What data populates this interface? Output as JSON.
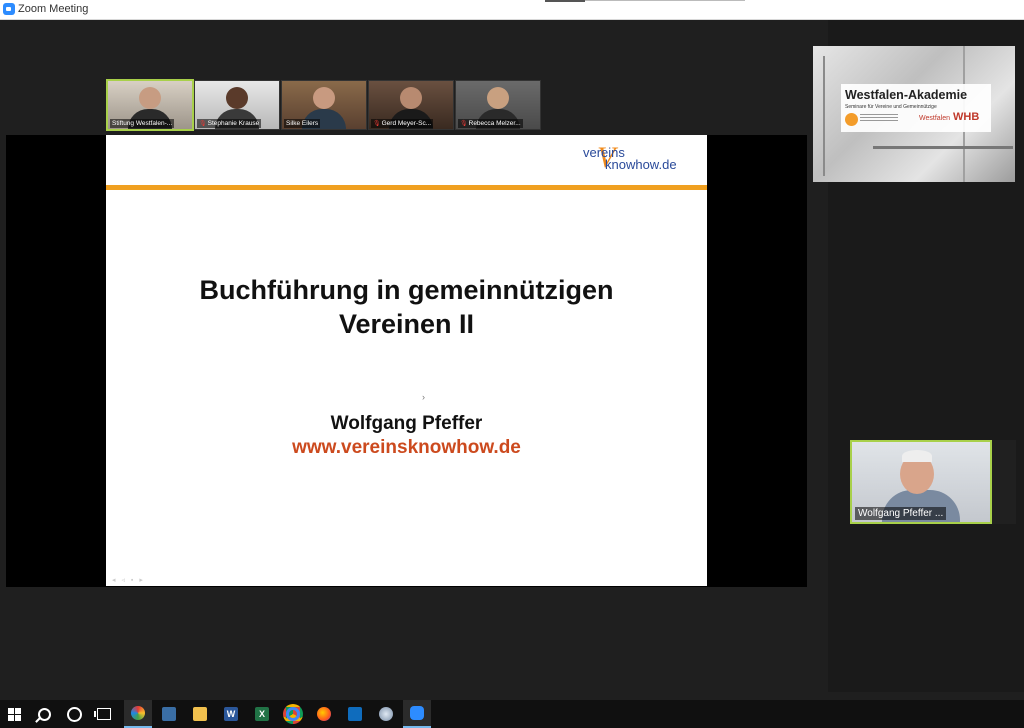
{
  "window": {
    "title": "Zoom Meeting"
  },
  "participants": [
    {
      "name": "Stiftung Westfalen-...",
      "muted": false,
      "active": true
    },
    {
      "name": "Stephanie Krause",
      "muted": true,
      "active": false
    },
    {
      "name": "Silke Eilers",
      "muted": false,
      "active": false
    },
    {
      "name": "Gerd Meyer-Sc...",
      "muted": true,
      "active": false
    },
    {
      "name": "Rebecca Melzer...",
      "muted": true,
      "active": false
    }
  ],
  "slide": {
    "logo_top": "vereins",
    "logo_v": "V",
    "logo_bottom": "knowhow.de",
    "title_line1": "Buchführung in gemeinnützigen",
    "title_line2": "Vereinen II",
    "cursor": "›",
    "author": "Wolfgang Pfeffer",
    "url": "www.vereinsknowhow.de",
    "controls": "◂ ◃ ▪ ▸"
  },
  "side_video_top": {
    "title": "Westfalen-Akademie",
    "subtitle": "Seminare für Vereine und Gemeinnützige",
    "logo_left": "Stiftung",
    "logo_mid": "Westfalen",
    "logo_right": "WHB"
  },
  "side_video_bottom": {
    "name": "Wolfgang Pfeffer ..."
  },
  "taskbar": {
    "word_label": "W",
    "excel_label": "X"
  },
  "colors": {
    "active_border": "#a8d04a",
    "accent_orange": "#f0a020",
    "url_red": "#cc4a1e",
    "zoom_blue": "#2d8cff"
  }
}
